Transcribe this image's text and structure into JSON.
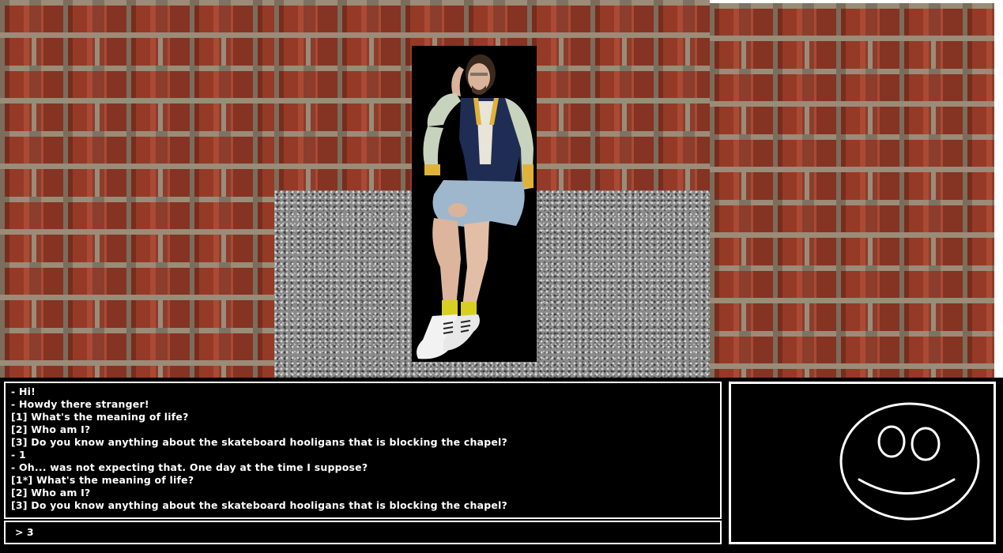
{
  "scene": {
    "character": "man-sitting-photo",
    "background": [
      "brick-wall",
      "gravel"
    ]
  },
  "dialogue": {
    "lines": [
      "- Hi!",
      "- Howdy there stranger!",
      "[1] What's the meaning of life?",
      "[2] Who am I?",
      "[3] Do you know anything about the skateboard hooligans that is blocking the chapel?",
      "- 1",
      "- Oh... was not expecting that. One day at the time I suppose?",
      "[1*] What's the meaning of life?",
      "[2] Who am I?",
      "[3] Do you know anything about the skateboard hooligans that is blocking the chapel?"
    ]
  },
  "input": {
    "prompt": ">",
    "value": "3"
  },
  "portrait": {
    "icon": "smiley-face-icon",
    "stroke_color": "#ffffff"
  }
}
